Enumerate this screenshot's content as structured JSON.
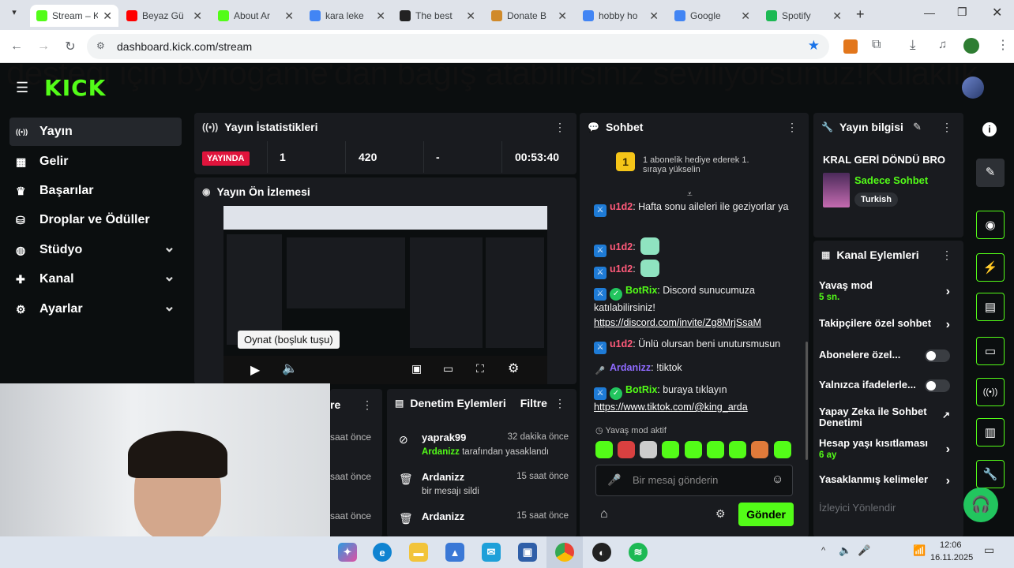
{
  "browser": {
    "tabs": [
      {
        "title": "Stream – K",
        "active": true,
        "favicon": "kick-favicon",
        "color": "#53fc18"
      },
      {
        "title": "Beyaz Gü",
        "favicon": "youtube-favicon",
        "color": "#ff0000"
      },
      {
        "title": "About Ar",
        "favicon": "kick-favicon",
        "color": "#53fc18"
      },
      {
        "title": "kara leke",
        "favicon": "google-favicon",
        "color": "#4285f4"
      },
      {
        "title": "The best",
        "favicon": "site-favicon",
        "color": "#222222"
      },
      {
        "title": "Donate B",
        "favicon": "donate-favicon",
        "color": "#d08a2a"
      },
      {
        "title": "hobby ho",
        "favicon": "google-favicon",
        "color": "#4285f4"
      },
      {
        "title": "Google",
        "favicon": "google-favicon",
        "color": "#4285f4"
      },
      {
        "title": "Spotify",
        "favicon": "spotify-favicon",
        "color": "#1db954"
      }
    ],
    "url": "dashboard.kick.com/stream"
  },
  "marquee": "desteği için bynogame'dan bağış atabilirsiniz seviliyorsunuz!Kulaklık",
  "logo": "KICK",
  "sidebar": {
    "items": [
      {
        "label": "Yayın",
        "icon": "broadcast-icon",
        "active": true
      },
      {
        "label": "Gelir",
        "icon": "revenue-icon"
      },
      {
        "label": "Başarılar",
        "icon": "trophy-icon"
      },
      {
        "label": "Droplar ve Ödüller",
        "icon": "drops-icon"
      },
      {
        "label": "Stüdyo",
        "icon": "studio-icon",
        "expandable": true
      },
      {
        "label": "Kanal",
        "icon": "channel-icon",
        "expandable": true
      },
      {
        "label": "Ayarlar",
        "icon": "settings-icon",
        "expandable": true
      }
    ]
  },
  "stats": {
    "title": "Yayın İstatistikleri",
    "live_label": "YAYINDA",
    "viewers": "1",
    "followers": "420",
    "other": "-",
    "duration": "00:53:40"
  },
  "preview": {
    "title": "Yayın Ön İzlemesi",
    "tooltip": "Oynat (boşluk tuşu)"
  },
  "partial_panel": {
    "title_fragment": "re",
    "times": [
      "saat önce",
      "saat önce",
      "saat önce"
    ]
  },
  "moderation": {
    "title": "Denetim Eylemleri",
    "filter": "Filtre",
    "rows": [
      {
        "user": "yaprak99",
        "time": "32 dakika önce",
        "actor": "Ardanizz",
        "action": " tarafından yasaklandı",
        "icon": "ban-icon"
      },
      {
        "user": "Ardanizz",
        "time": "15 saat önce",
        "action": "bir mesajı sildi",
        "icon": "trash-icon"
      },
      {
        "user": "Ardanizz",
        "time": "15 saat önce",
        "action": "",
        "icon": "trash-icon"
      }
    ]
  },
  "chat": {
    "title": "Sohbet",
    "pinned": "1 abonelik hediye ederek 1. sıraya yükselin",
    "pinned_rank": "1",
    "messages": [
      {
        "user": "u1d2",
        "text": ": Hafta sonu aileleri ile geziyorlar ya"
      },
      {
        "user": "u1d2",
        "text": ":"
      },
      {
        "user": "u1d2",
        "text": ":"
      },
      {
        "user": "BotRix",
        "text": ": Discord sunucumuza katılabilirsiniz!",
        "link": "https://discord.com/invite/Zg8MrjSsaM"
      },
      {
        "user": "u1d2",
        "text": ": Ünlü olursan beni unutursmusun"
      },
      {
        "user": "Ardanizz",
        "text": ": !tiktok"
      },
      {
        "user": "BotRix",
        "text": ": buraya tıklayın",
        "link": "https://www.tiktok.com/@king_arda"
      }
    ],
    "slow_mode": "Yavaş mod aktif",
    "placeholder": "Bir mesaj gönderin",
    "send": "Gönder"
  },
  "stream_info": {
    "title": "Yayın bilgisi",
    "stream_title": "KRAL GERİ DÖNDÜ BRO",
    "category": "Sadece Sohbet",
    "language": "Turkish"
  },
  "channel_actions": {
    "title": "Kanal Eylemleri",
    "rows": [
      {
        "label": "Yavaş mod",
        "sub": "5 sn.",
        "type": "chevron"
      },
      {
        "label": "Takipçilere özel sohbet",
        "type": "chevron"
      },
      {
        "label": "Abonelere özel...",
        "type": "toggle"
      },
      {
        "label": "Yalnızca ifadelerle...",
        "type": "toggle"
      },
      {
        "label": "Yapay Zeka ile Sohbet Denetimi",
        "type": "external"
      },
      {
        "label": "Hesap yaşı kısıtlaması",
        "sub": "6 ay",
        "type": "chevron"
      },
      {
        "label": "Yasaklanmış kelimeler",
        "type": "chevron"
      },
      {
        "label": "İzleyici Yönlendir",
        "type": "disabled"
      }
    ]
  },
  "taskbar": {
    "time": "12:06",
    "date": "16.11.2025"
  }
}
